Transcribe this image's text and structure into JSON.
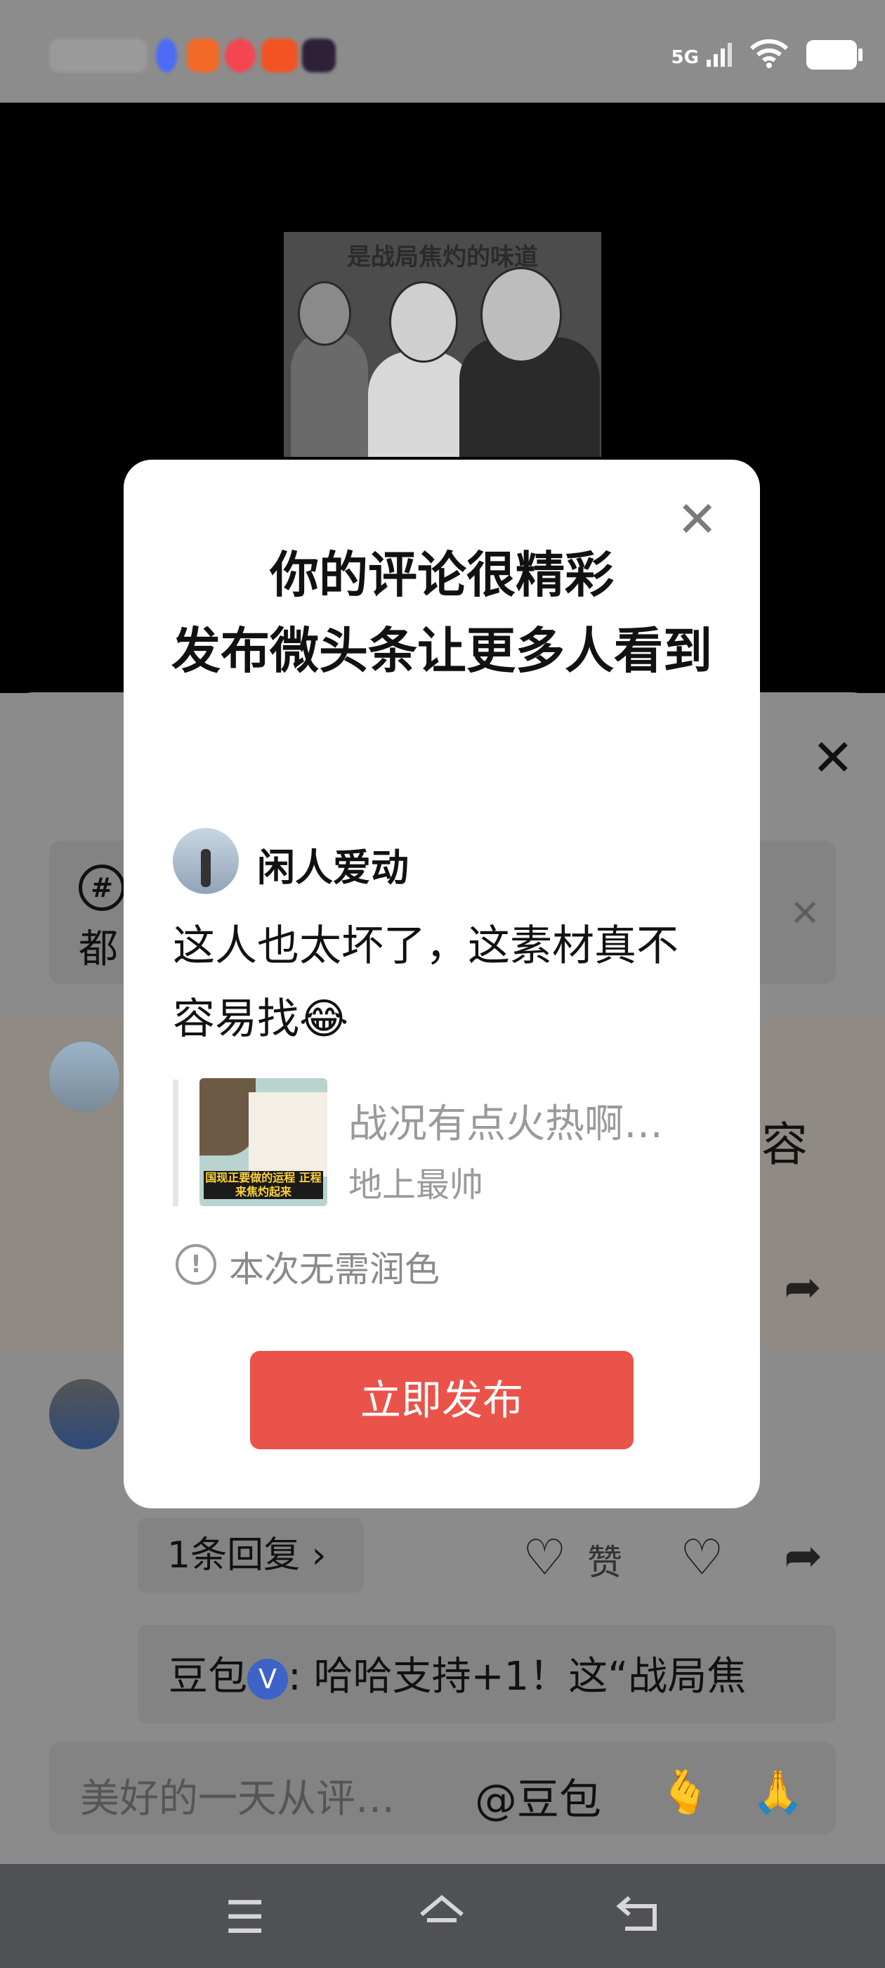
{
  "status_bar": {
    "network": "5G",
    "icons": [
      "signal-icon",
      "wifi-icon",
      "battery-icon"
    ]
  },
  "video": {
    "caption": "是战局焦灼的味道"
  },
  "comment_sheet": {
    "close_icon": "close-icon",
    "topic_prefix_char": "都",
    "visible_text_right": "容",
    "reply_count_label": "1条回复 ›",
    "like_label": "赞",
    "reply_preview": {
      "author": "豆包",
      "verified_mark": "V",
      "text": ": 哈哈支持+1！这“战局焦"
    }
  },
  "input_bar": {
    "placeholder": "美好的一天从评…",
    "mention": "@豆包",
    "emoji_1": "🫰",
    "emoji_2": "🙏"
  },
  "dialog": {
    "title_line_1": "你的评论很精彩",
    "title_line_2": "发布微头条让更多人看到",
    "user_name": "闲人爱动",
    "comment_text": "这人也太坏了，这素材真不容易找😂",
    "quote": {
      "title": "战况有点火热啊…",
      "author": "地上最帅",
      "thumbnail_text": "国现正要做的运程 正程来焦灼起来"
    },
    "notice_icon": "!",
    "notice_text": "本次无需润色",
    "publish_label": "立即发布"
  },
  "colors": {
    "publish_button": "#ea5349",
    "overlay": "#8a8a8a",
    "verified_badge": "#3d63c9"
  }
}
